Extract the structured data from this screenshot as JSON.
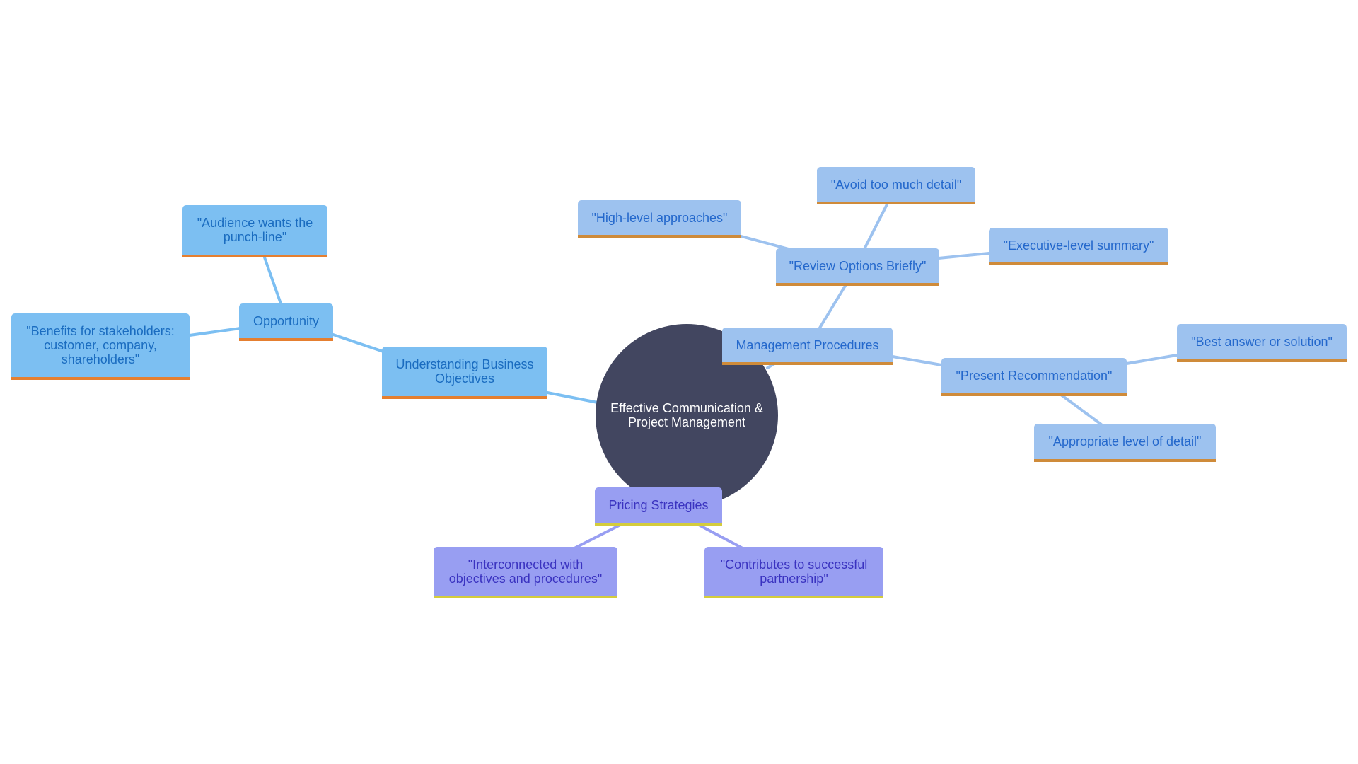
{
  "diagram": {
    "type": "mind-map",
    "root": {
      "label": "Effective Communication & Project Management"
    },
    "colors": {
      "root_fill": "#424660",
      "left_branch_fill": "#7cbff2",
      "left_branch_text": "#1a6cc0",
      "left_branch_accent": "#e57f30",
      "management_branch_fill": "#9dc2ef",
      "management_branch_text": "#2468cc",
      "management_branch_accent": "#cf8b3a",
      "pricing_branch_fill": "#989ef2",
      "pricing_branch_text": "#3a33c0",
      "pricing_branch_accent": "#d4cc3c"
    },
    "branches": {
      "objectives": {
        "label": "Understanding Business Objectives",
        "opportunity": {
          "label": "Opportunity",
          "children": [
            "\"Audience wants the punch-line\"",
            "\"Benefits for stakeholders: customer, company, shareholders\""
          ]
        }
      },
      "management": {
        "label": "Management Procedures",
        "review": {
          "label": "\"Review Options Briefly\"",
          "children": [
            "\"High-level approaches\"",
            "\"Avoid too much detail\"",
            "\"Executive-level summary\""
          ]
        },
        "present": {
          "label": "\"Present Recommendation\"",
          "children": [
            "\"Best answer or solution\"",
            "\"Appropriate level of detail\""
          ]
        }
      },
      "pricing": {
        "label": "Pricing Strategies",
        "children": [
          "\"Interconnected with objectives and procedures\"",
          "\"Contributes to successful partnership\""
        ]
      }
    }
  }
}
